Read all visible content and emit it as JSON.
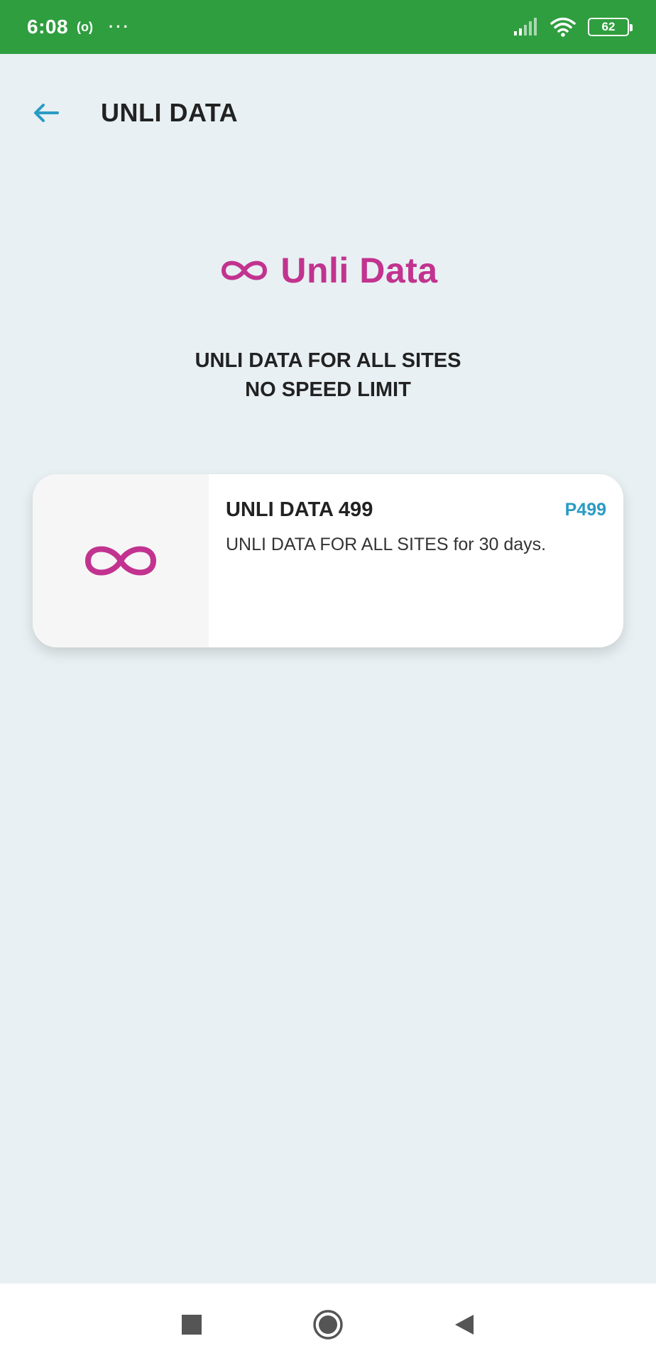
{
  "status_bar": {
    "time": "6:08",
    "radio_indicator": "(o)",
    "more_dots": "···",
    "battery_level": "62",
    "icons": [
      "signal-icon",
      "wifi-icon",
      "battery-icon"
    ]
  },
  "header": {
    "title": "UNLI DATA",
    "back_icon": "back-arrow-icon"
  },
  "brand": {
    "logo_icon": "infinity-icon",
    "name": "Unli Data"
  },
  "tagline": {
    "line1": "UNLI DATA FOR ALL SITES",
    "line2": "NO SPEED LIMIT"
  },
  "plans": [
    {
      "icon": "infinity-icon",
      "title": "UNLI DATA 499",
      "price": "P499",
      "description": "UNLI DATA FOR ALL SITES for 30 days."
    }
  ],
  "nav_bar": {
    "icons": [
      "recents-square-icon",
      "home-circle-icon",
      "back-triangle-icon"
    ]
  },
  "colors": {
    "status_bar": "#2f9e3f",
    "background": "#e8f0f3",
    "brand": "#c2338f",
    "accent": "#2a9bc4",
    "text": "#222222"
  }
}
